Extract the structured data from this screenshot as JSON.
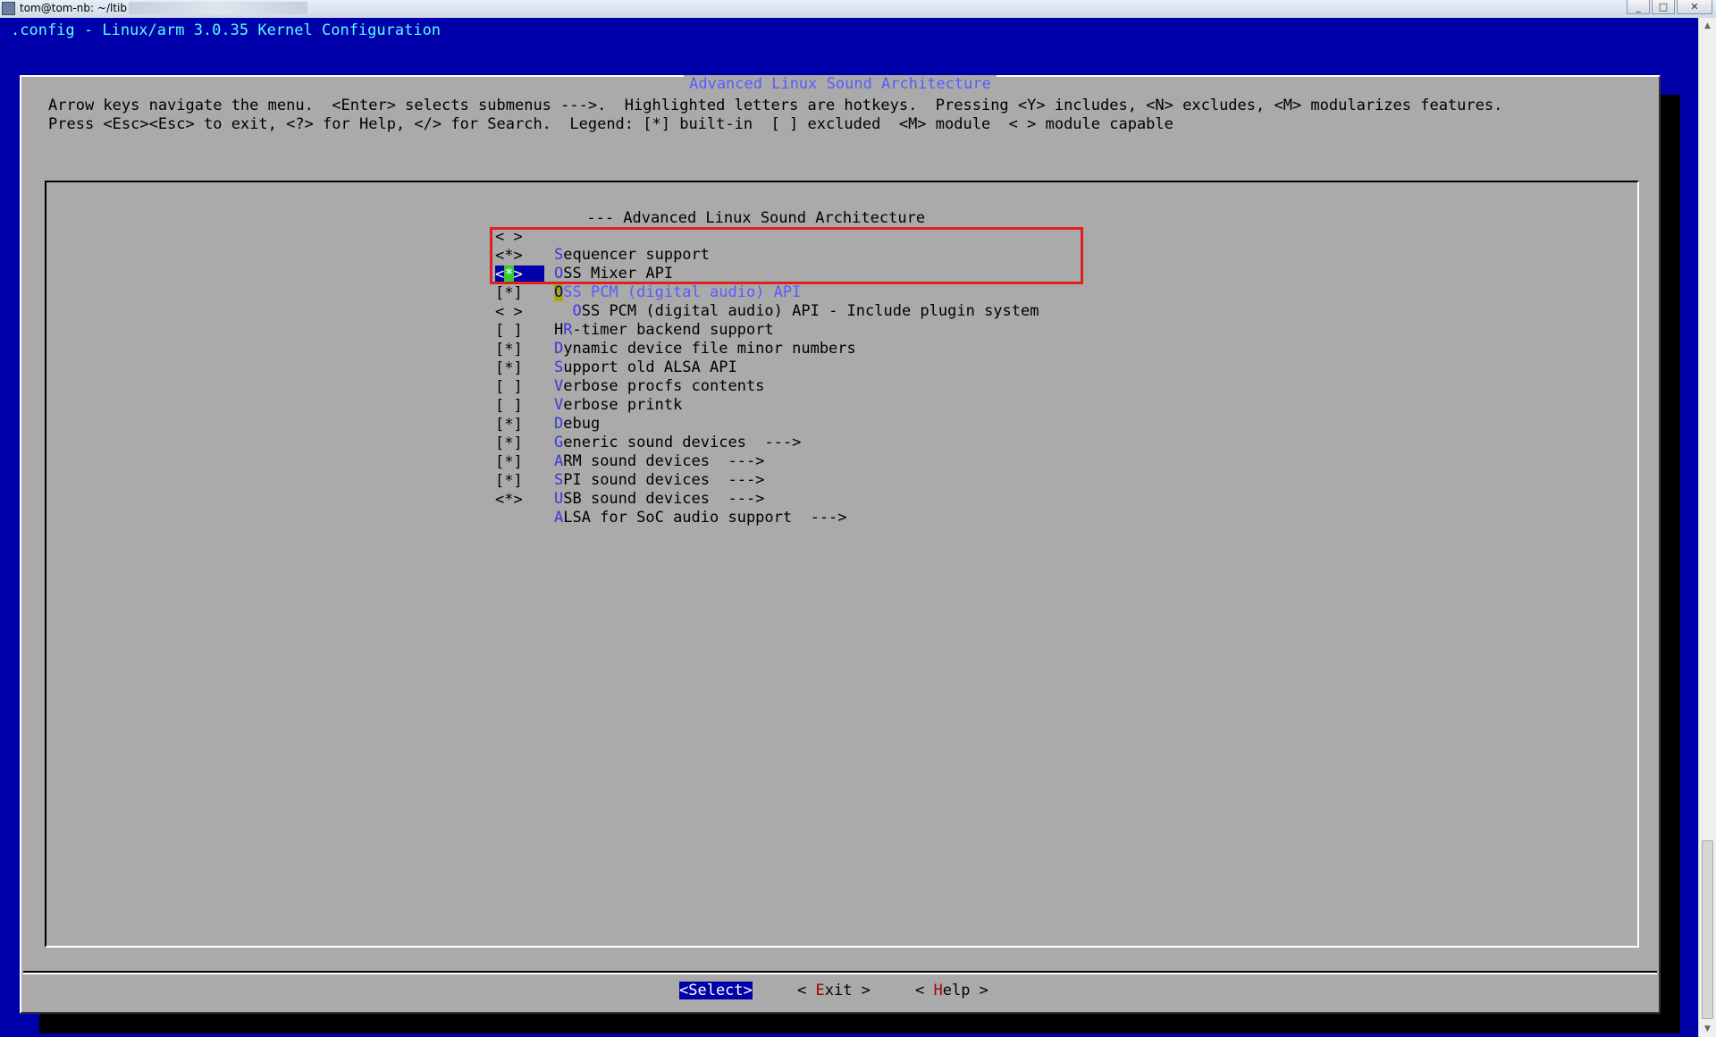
{
  "window": {
    "title": "tom@tom-nb: ~/ltib",
    "buttons": {
      "minimize": "_",
      "maximize": "□",
      "close": "✕"
    }
  },
  "terminal": {
    "config_title": ".config - Linux/arm 3.0.35 Kernel Configuration"
  },
  "dialog": {
    "title": "Advanced Linux Sound Architecture",
    "help_line1": "Arrow keys navigate the menu.  <Enter> selects submenus --->.  Highlighted letters are hotkeys.  Pressing <Y> includes, <N> excludes, <M> modularizes features.",
    "help_line2": "Press <Esc><Esc> to exit, <?> for Help, </> for Search.  Legend: [*] built-in  [ ] excluded  <M> module  < > module capable",
    "menu_header": "--- Advanced Linux Sound Architecture",
    "items": [
      {
        "mark": "< >",
        "hot": "S",
        "rest": "equencer support"
      },
      {
        "mark": "<*>",
        "hot": "O",
        "rest": "SS Mixer API"
      },
      {
        "mark_open": "<",
        "mark_cursor": "*",
        "mark_close": ">",
        "hot": "O",
        "rest": "SS PCM (digital audio) API",
        "selected": true
      },
      {
        "mark": "[*]",
        "indent": "  ",
        "hot": "O",
        "rest": "SS PCM (digital audio) API - Include plugin system"
      },
      {
        "mark": "< >",
        "pre": "H",
        "hot": "R",
        "rest": "-timer backend support"
      },
      {
        "mark": "[ ]",
        "hot": "D",
        "rest": "ynamic device file minor numbers"
      },
      {
        "mark": "[*]",
        "hot": "S",
        "rest": "upport old ALSA API"
      },
      {
        "mark": "[*]",
        "hot": "V",
        "rest": "erbose procfs contents"
      },
      {
        "mark": "[ ]",
        "hot": "V",
        "rest": "erbose printk"
      },
      {
        "mark": "[ ]",
        "hot": "D",
        "rest": "ebug"
      },
      {
        "mark": "[*]",
        "hot": "G",
        "rest": "eneric sound devices  --->"
      },
      {
        "mark": "[*]",
        "hot": "A",
        "rest": "RM sound devices  --->"
      },
      {
        "mark": "[*]",
        "hot": "S",
        "rest": "PI sound devices  --->"
      },
      {
        "mark": "[*]",
        "hot": "U",
        "rest": "SB sound devices  --->"
      },
      {
        "mark": "<*>",
        "hot": "A",
        "rest": "LSA for SoC audio support  --->"
      }
    ],
    "buttons": {
      "select": "<Select>",
      "exit_open": "< ",
      "exit_hot": "E",
      "exit_rest": "xit >",
      "help_open": "< ",
      "help_hot": "H",
      "help_rest": "elp >"
    }
  },
  "annotation": {
    "color": "#e02020"
  },
  "colors": {
    "terminal_bg": "#0000aa",
    "dialog_bg": "#aaaaaa",
    "title_cyan": "#55ffff",
    "hotkey_blue": "#3a3ad8",
    "cursor_green": "#33cc33"
  }
}
